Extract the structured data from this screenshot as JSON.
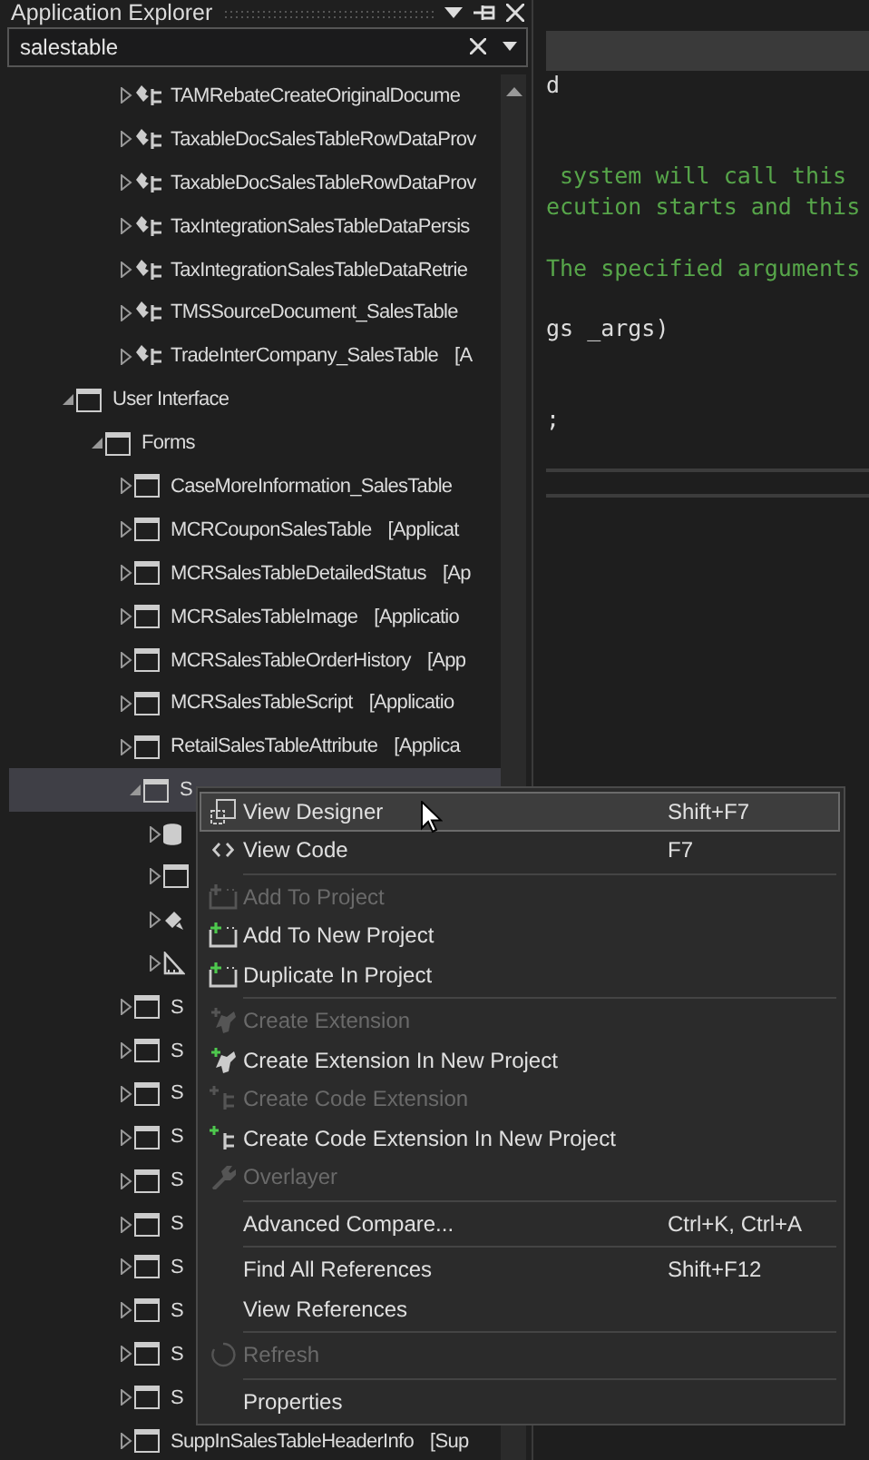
{
  "explorer": {
    "title": "Application Explorer",
    "search": {
      "value": "salestable"
    }
  },
  "tree": {
    "above": [
      {
        "label": "TAMRebateCreateOriginalDocume",
        "kind": "class",
        "expanded": false,
        "selected": false
      },
      {
        "label": "TaxableDocSalesTableRowDataProv",
        "kind": "class",
        "expanded": false,
        "selected": false
      },
      {
        "label": "TaxableDocSalesTableRowDataProv",
        "kind": "class",
        "expanded": false,
        "selected": false
      },
      {
        "label": "TaxIntegrationSalesTableDataPersis",
        "kind": "class",
        "expanded": false,
        "selected": false
      },
      {
        "label": "TaxIntegrationSalesTableDataRetrie",
        "kind": "class",
        "expanded": false,
        "selected": false
      },
      {
        "label": "TMSSourceDocument_SalesTable",
        "kind": "class",
        "expanded": false,
        "selected": false
      },
      {
        "label": "TradeInterCompany_SalesTable",
        "model": "[A",
        "kind": "class",
        "expanded": false,
        "selected": false
      }
    ],
    "nodes": [
      {
        "label": "User Interface",
        "kind": "folder",
        "expanded": true,
        "selected": false,
        "children": [
          {
            "label": "Forms",
            "kind": "folder",
            "expanded": true,
            "selected": false,
            "children": [
              {
                "label": "CaseMoreInformation_SalesTable",
                "kind": "form",
                "expanded": false,
                "selected": false
              },
              {
                "label": "MCRCouponSalesTable",
                "model": "[Applicat",
                "kind": "form",
                "expanded": false,
                "selected": false
              },
              {
                "label": "MCRSalesTableDetailedStatus",
                "model": "[Ap",
                "kind": "form",
                "expanded": false,
                "selected": false
              },
              {
                "label": "MCRSalesTableImage",
                "model": "[Applicatio",
                "kind": "form",
                "expanded": false,
                "selected": false
              },
              {
                "label": "MCRSalesTableOrderHistory",
                "model": "[App",
                "kind": "form",
                "expanded": false,
                "selected": false
              },
              {
                "label": "MCRSalesTableScript",
                "model": "[Applicatio",
                "kind": "form",
                "expanded": false,
                "selected": false
              },
              {
                "label": "RetailSalesTableAttribute",
                "model": "[Applica",
                "kind": "form",
                "expanded": false,
                "selected": false
              },
              {
                "label": "S",
                "kind": "form",
                "expanded": true,
                "selected": true,
                "children": [
                  {
                    "kind": "datasource",
                    "expanded": false,
                    "selected": false
                  },
                  {
                    "kind": "form",
                    "expanded": false,
                    "selected": false
                  },
                  {
                    "kind": "brush",
                    "expanded": false,
                    "selected": false
                  },
                  {
                    "kind": "ruler",
                    "expanded": false,
                    "selected": false
                  }
                ]
              },
              {
                "label": "S",
                "kind": "form",
                "expanded": false,
                "selected": false
              },
              {
                "label": "S",
                "kind": "form",
                "expanded": false,
                "selected": false
              },
              {
                "label": "S",
                "kind": "form",
                "expanded": false,
                "selected": false
              },
              {
                "label": "S",
                "kind": "form",
                "expanded": false,
                "selected": false
              },
              {
                "label": "S",
                "kind": "form",
                "expanded": false,
                "selected": false
              },
              {
                "label": "S",
                "kind": "form",
                "expanded": false,
                "selected": false
              },
              {
                "label": "S",
                "kind": "form",
                "expanded": false,
                "selected": false
              },
              {
                "label": "S",
                "kind": "form",
                "expanded": false,
                "selected": false
              },
              {
                "label": "S",
                "kind": "form",
                "expanded": false,
                "selected": false
              },
              {
                "label": "S",
                "kind": "form",
                "expanded": false,
                "selected": false
              },
              {
                "label": "SuppInSalesTableHeaderInfo",
                "model": "[Sup",
                "kind": "form",
                "expanded": false,
                "selected": false
              }
            ]
          }
        ]
      }
    ]
  },
  "editor": {
    "lines": [
      {
        "text": "d",
        "kind": "code"
      },
      {
        "text": " system will call this",
        "kind": "comment"
      },
      {
        "text": "ecution starts and this",
        "kind": "comment"
      },
      {
        "text": "The specified arguments",
        "kind": "comment"
      },
      {
        "text": "gs _args)",
        "kind": "code"
      },
      {
        "text": ";",
        "kind": "code"
      }
    ]
  },
  "context_menu": [
    {
      "kind": "designer",
      "label": "View Designer",
      "shortcut": "Shift+F7",
      "disabled": false,
      "selected": true
    },
    {
      "kind": "code",
      "label": "View Code",
      "shortcut": "F7",
      "disabled": false,
      "selected": false
    },
    {
      "kind": "separator"
    },
    {
      "kind": "add",
      "label": "Add To Project",
      "disabled": true,
      "selected": false
    },
    {
      "kind": "add",
      "label": "Add To New Project",
      "disabled": false,
      "selected": false
    },
    {
      "kind": "add",
      "label": "Duplicate In Project",
      "disabled": false,
      "selected": false
    },
    {
      "kind": "separator"
    },
    {
      "kind": "extension",
      "label": "Create Extension",
      "disabled": true,
      "selected": false
    },
    {
      "kind": "extension",
      "label": "Create Extension In New Project",
      "disabled": false,
      "selected": false
    },
    {
      "kind": "code-extension",
      "label": "Create Code Extension",
      "disabled": true,
      "selected": false
    },
    {
      "kind": "code-extension",
      "label": "Create Code Extension In New Project",
      "disabled": false,
      "selected": false
    },
    {
      "kind": "wrench",
      "label": "Overlayer",
      "disabled": true,
      "selected": false
    },
    {
      "kind": "separator"
    },
    {
      "kind": "plain",
      "label": "Advanced Compare...",
      "shortcut": "Ctrl+K, Ctrl+A",
      "disabled": false,
      "selected": false
    },
    {
      "kind": "separator"
    },
    {
      "kind": "plain",
      "label": "Find All References",
      "shortcut": "Shift+F12",
      "disabled": false,
      "selected": false
    },
    {
      "kind": "plain",
      "label": "View References",
      "disabled": false,
      "selected": false
    },
    {
      "kind": "separator"
    },
    {
      "kind": "refresh",
      "label": "Refresh",
      "disabled": true,
      "selected": false
    },
    {
      "kind": "separator"
    },
    {
      "kind": "plain",
      "label": "Properties",
      "disabled": false,
      "selected": false
    }
  ]
}
